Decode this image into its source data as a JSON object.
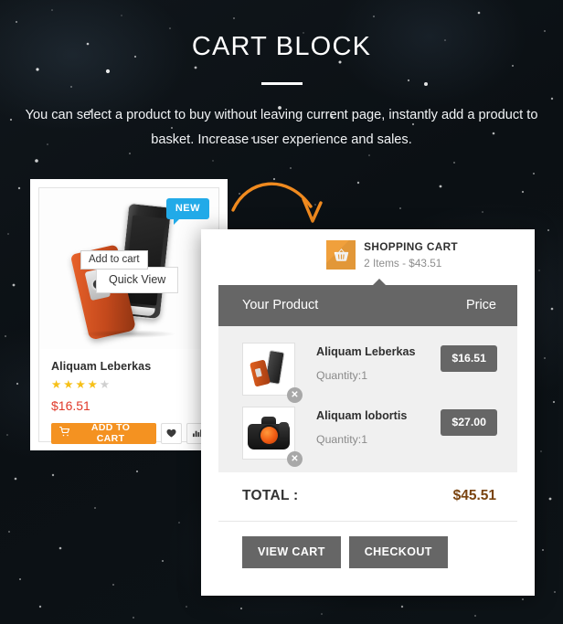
{
  "header": {
    "title": "CART BLOCK",
    "subtitle": "You can select a product to buy without leaving current page, instantly add a product to basket. Increase user experience and sales."
  },
  "product_card": {
    "badge": "NEW",
    "quick_view": "Quick View",
    "name": "Aliquam Leberkas",
    "rating": 4,
    "rating_max": 5,
    "price": "$16.51",
    "add_to_cart_label": "ADD TO CART",
    "wishlist_icon": "heart-icon",
    "compare_icon": "compare-icon",
    "cart_icon": "cart-icon",
    "tooltip": "Add to cart"
  },
  "cart": {
    "title": "SHOPPING CART",
    "summary": "2 Items - $43.51",
    "basket_icon": "basket-icon",
    "columns": {
      "product": "Your Product",
      "price": "Price"
    },
    "items": [
      {
        "name": "Aliquam Leberkas",
        "quantity": "Quantity:1",
        "price": "$16.51",
        "thumb": "phone-thumbnail",
        "remove_icon": "close-icon",
        "remove_label": "✕"
      },
      {
        "name": "Aliquam lobortis",
        "quantity": "Quantity:1",
        "price": "$27.00",
        "thumb": "camera-thumbnail",
        "remove_icon": "close-icon",
        "remove_label": "✕"
      }
    ],
    "total_label": "TOTAL :",
    "total_value": "$45.51",
    "view_cart_label": "VIEW CART",
    "checkout_label": "CHECKOUT"
  },
  "annotation": {
    "arrow_icon": "curved-arrow-icon"
  },
  "colors": {
    "accent_orange": "#f49221",
    "basket_orange": "#f0a03c",
    "badge_blue": "#22aae8",
    "grey": "#666666",
    "price_red": "#e0392a",
    "star_gold": "#f6c018",
    "total_brown": "#7a4410",
    "background": "#0c1115"
  }
}
